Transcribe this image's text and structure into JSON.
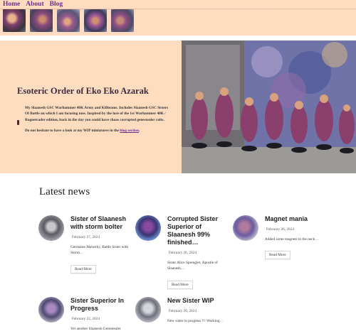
{
  "nav": [
    "Home",
    "About",
    "Blog"
  ],
  "thumbnails": [
    "thumbnail-1",
    "thumbnail-2",
    "thumbnail-3",
    "thumbnail-4",
    "thumbnail-5"
  ],
  "hero": {
    "title": "Esoteric Order of Eko Eko Azarak",
    "paragraph1": "My Slaanesh GSC Warhammer 40K Army and Killteams. Includes Slaanesh GSC Sisters Of Battle on which I am focusing now. Inspired by the lore of the 1st Warhammer 40K / Roguetrader edition, back in the day you could have chaos corrupted genestealer cults.",
    "paragraph2_prefix": "Do not hesitate to have a look at my WIP miniatures in the ",
    "paragraph2_link": "blog section",
    "paragraph2_suffix": "."
  },
  "news": {
    "heading": "Latest news",
    "button_label": "Read More",
    "posts": [
      {
        "title": "Sister of Slaanesh with storm bolter",
        "date": "February 27, 2024",
        "excerpt": "Germaine Malorthy, Battle Sister with Storm…",
        "has_button": true
      },
      {
        "title": "Corrupted Sister Superior of Slaanesh 99% finished…",
        "date": "February 26, 2024",
        "excerpt": "Sister Alice Sprengler, Apostle of Slaanesh…",
        "has_button": true
      },
      {
        "title": "Magnet mania",
        "date": "February 26, 2024",
        "excerpt": "Added some magnets to the neck…",
        "has_button": true
      },
      {
        "title": "Sister Superior In Progress",
        "date": "February 22, 2024",
        "excerpt": "Yet another Slaanesh Genestealer",
        "has_button": false
      },
      {
        "title": "New Sister WIP",
        "date": "February 20, 2024",
        "excerpt": "New sister in progress !!! Working…",
        "has_button": false
      }
    ]
  }
}
